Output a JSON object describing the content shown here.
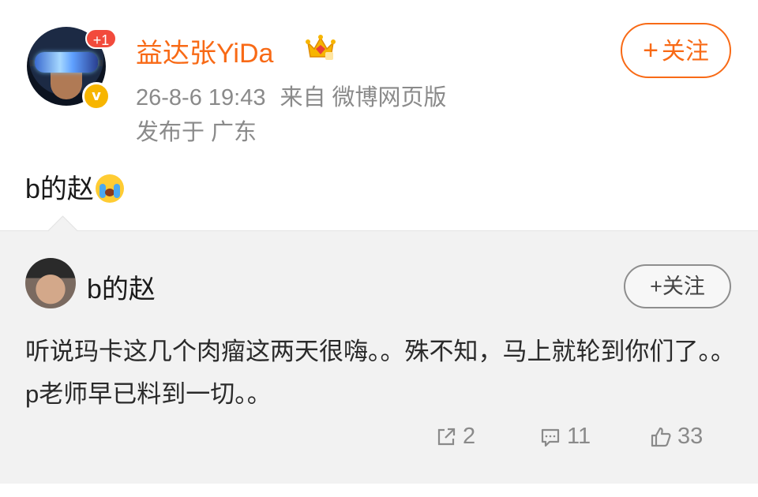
{
  "post": {
    "author": "益达张YiDa",
    "notification_badge": "+1",
    "verified_badge": "v",
    "timestamp": "26-8-6 19:43",
    "source": "来自 微博网页版",
    "location": "发布于 广东",
    "follow_plus": "+",
    "follow_label": "关注",
    "text": "b的赵"
  },
  "repost": {
    "author": "b的赵",
    "follow_label": "+关注",
    "text": "听说玛卡这几个肉瘤这两天很嗨。。殊不知，马上就轮到你们了。。p老师早已料到一切。。",
    "actions": {
      "share_count": "2",
      "comment_count": "11",
      "like_count": "33"
    }
  },
  "colors": {
    "accent_orange": "#f86a16",
    "badge_red": "#f24a3c",
    "verified_gold": "#f7b500",
    "muted_gray": "#8a8a8a",
    "repost_bg": "#f2f2f2"
  },
  "icons": [
    "vr-avatar-icon",
    "crown-icon",
    "crying-emoji-icon",
    "share-icon",
    "comment-icon",
    "like-icon"
  ]
}
